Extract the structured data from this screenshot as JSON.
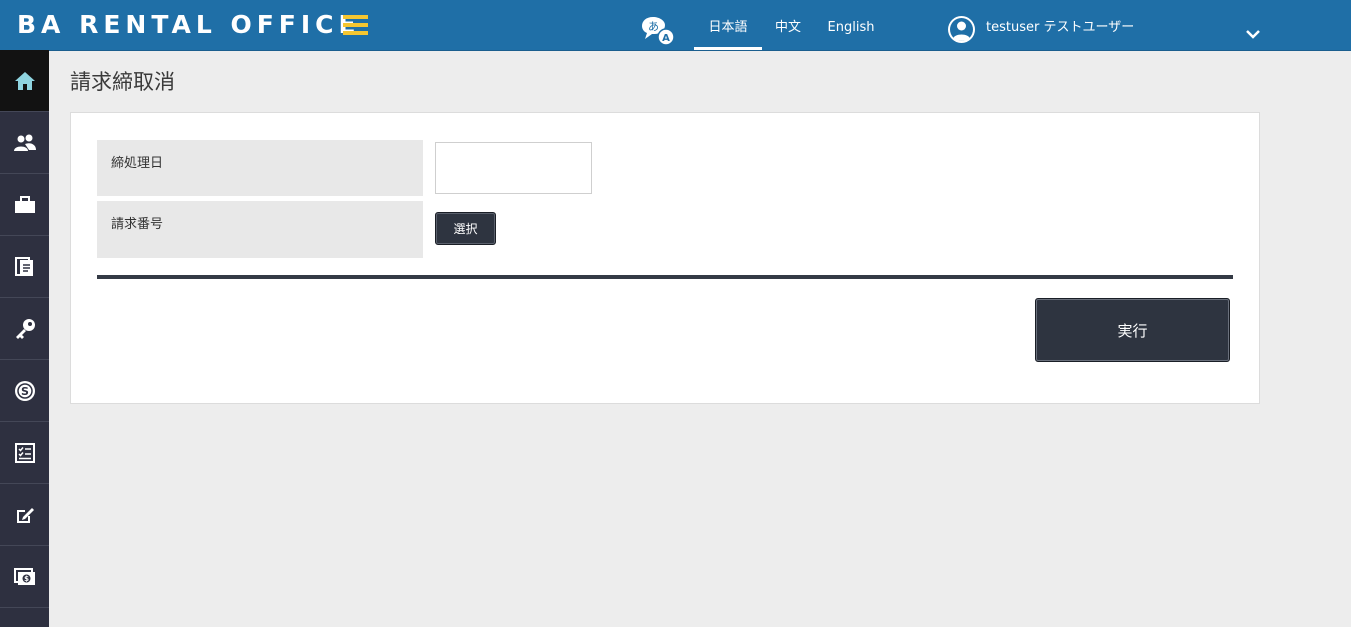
{
  "header": {
    "brand": "BA RENTAL OFFICE",
    "languages": [
      "日本語",
      "中文",
      "English"
    ],
    "active_language": "日本語",
    "user": "testuser テストユーザー",
    "accent_color": "#1f6fa7",
    "hamburger_color": "#f5c631"
  },
  "sidebar": {
    "icons": [
      "home-icon",
      "users-icon",
      "briefcase-icon",
      "documents-icon",
      "key-icon",
      "coin-icon",
      "checklist-icon",
      "edit-icon",
      "money-icon"
    ],
    "active": "home-icon"
  },
  "page": {
    "title": "請求締取消",
    "fields": {
      "closing_date_label": "締処理日",
      "closing_date_value": "",
      "invoice_number_label": "請求番号",
      "select_button": "選択"
    },
    "execute_button": "実行"
  }
}
